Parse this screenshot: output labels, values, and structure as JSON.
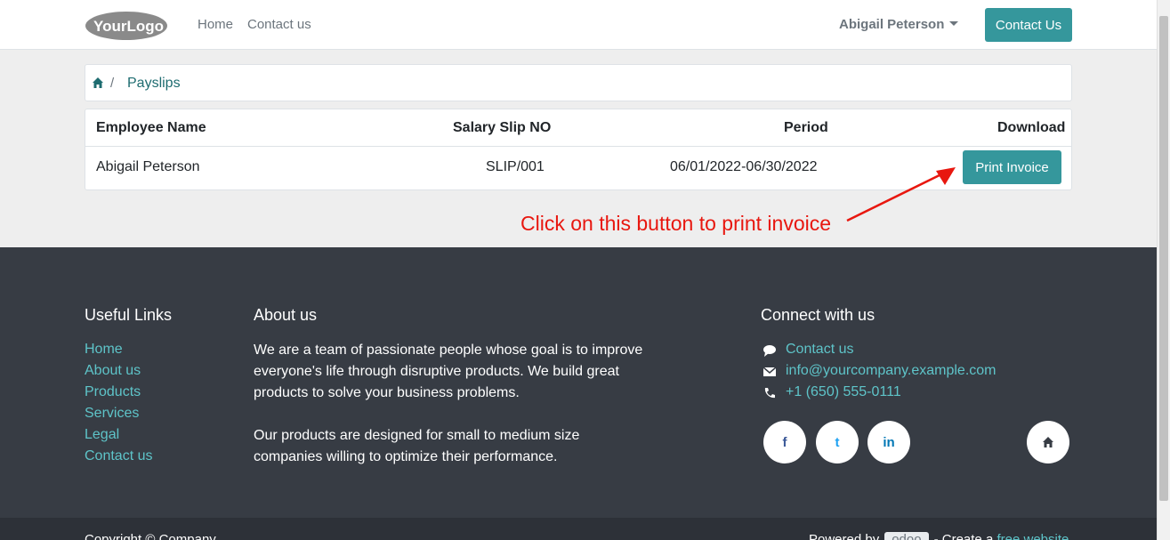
{
  "header": {
    "logo_text": "YourLogo",
    "nav": [
      "Home",
      "Contact us"
    ],
    "user_name": "Abigail Peterson",
    "contact_button": "Contact Us"
  },
  "breadcrumb": {
    "separator": "/",
    "current": "Payslips"
  },
  "table": {
    "headers": [
      "Employee Name",
      "Salary Slip NO",
      "Period",
      "Download"
    ],
    "rows": [
      {
        "employee": "Abigail Peterson",
        "slip_no": "SLIP/001",
        "period": "06/01/2022-06/30/2022",
        "action": "Print Invoice"
      }
    ]
  },
  "annotation": {
    "text": "Click on this button to print invoice",
    "color": "#e8170f"
  },
  "footer": {
    "useful_links": {
      "title": "Useful Links",
      "items": [
        "Home",
        "About us",
        "Products",
        "Services",
        "Legal",
        "Contact us"
      ]
    },
    "about": {
      "title": "About us",
      "paragraph1": "We are a team of passionate people whose goal is to improve everyone's life through disruptive products. We build great products to solve your business problems.",
      "paragraph2": "Our products are designed for small to medium size companies willing to optimize their performance."
    },
    "connect": {
      "title": "Connect with us",
      "contact": "Contact us",
      "email": "info@yourcompany.example.com",
      "phone": "+1 (650) 555-0111"
    },
    "social": [
      "f",
      "t",
      "in",
      "home"
    ]
  },
  "bottom": {
    "copyright": "Copyright © Company",
    "powered_prefix": "Powered by",
    "powered_brand": "odoo",
    "powered_mid": "- Create a",
    "powered_link": "free website"
  },
  "colors": {
    "accent": "#35979c",
    "link": "#5ec4c9",
    "footer_bg": "#373c44",
    "annotation": "#e8170f"
  }
}
